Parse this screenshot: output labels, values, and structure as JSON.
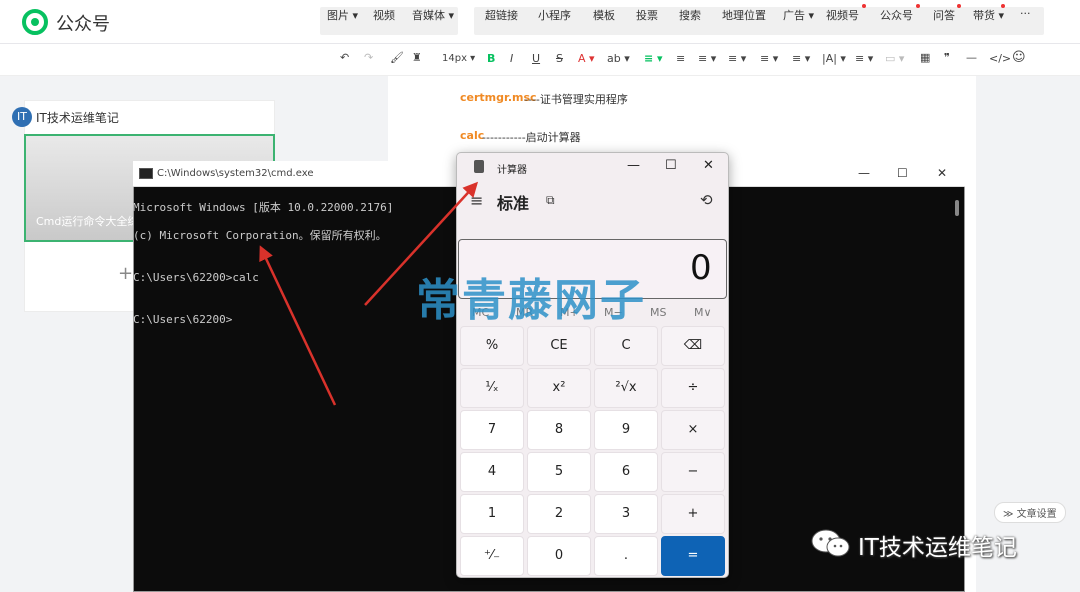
{
  "app": {
    "brand": "公众号"
  },
  "menu": {
    "group1": [
      "图片 ▾",
      "视频",
      "音媒体 ▾"
    ],
    "group2": [
      "超链接",
      "小程序",
      "模板",
      "投票",
      "搜索",
      "地理位置",
      "广告 ▾",
      "视频号",
      "公众号",
      "问答",
      "带货 ▾",
      "···"
    ]
  },
  "toolbar": {
    "items": [
      "↶",
      "↷",
      "🖌",
      "♜",
      "14px ▾",
      "B",
      "I",
      "U",
      "S",
      "A ▾",
      "ab ▾",
      "≡ ▾",
      "≡",
      "≡ ▾",
      "≡ ▾",
      "≡ ▾",
      "≡ ▾",
      "|A| ▾",
      "≡ ▾",
      "▭ ▾",
      "▦",
      "❞",
      "—",
      "</>",
      "☺"
    ]
  },
  "left_panel": {
    "title": "IT技术运维笔记",
    "card_text": "Cmd运行命令大全综",
    "plus": "+"
  },
  "editor": {
    "line1_cmd": "certmgr.msc",
    "line1_desc": "----证书管理实用程序",
    "line2_cmd": "calc",
    "line2_desc": "-----------启动计算器"
  },
  "cmd": {
    "title": "C:\\Windows\\system32\\cmd.exe",
    "lines": [
      "Microsoft Windows [版本 10.0.22000.2176]",
      "(c) Microsoft Corporation。保留所有权利。",
      "",
      "C:\\Users\\62200>calc",
      "",
      "C:\\Users\\62200>"
    ],
    "controls": [
      "—",
      "☐",
      "✕"
    ]
  },
  "calculator": {
    "title": "计算器",
    "controls": [
      "—",
      "☐",
      "✕"
    ],
    "mode": "标准",
    "keep_on_top": "⧉",
    "history": "⟲",
    "menu": "≡",
    "display": "0",
    "memory": [
      "MC",
      "MR",
      "M+",
      "M−",
      "MS",
      "M∨"
    ],
    "keys": [
      [
        "%",
        "CE",
        "C",
        "⌫"
      ],
      [
        "¹⁄ₓ",
        "x²",
        "²√x",
        "÷"
      ],
      [
        "7",
        "8",
        "9",
        "×"
      ],
      [
        "4",
        "5",
        "6",
        "−"
      ],
      [
        "1",
        "2",
        "3",
        "+"
      ],
      [
        "⁺⁄₋",
        "0",
        ".",
        "="
      ]
    ]
  },
  "watermark": "常青藤网子",
  "footer": {
    "account": "IT技术运维笔记",
    "article_setting": "≫ 文章设置"
  },
  "colors": {
    "accent_green": "#07c160",
    "calc_equals": "#0e63b5",
    "command_orange": "#f08a24",
    "arrow_red": "#d9322b"
  }
}
